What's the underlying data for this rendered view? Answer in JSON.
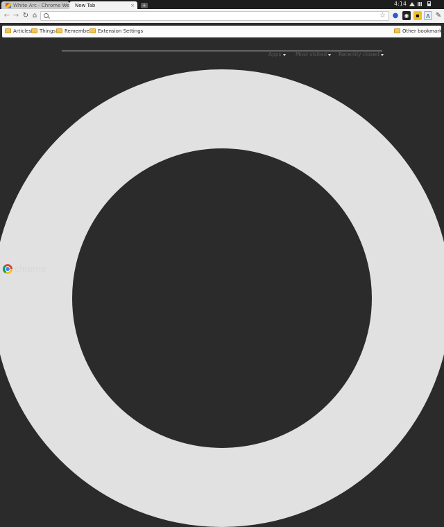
{
  "tabs": [
    {
      "title": "White Arc - Chrome We...",
      "close": "×"
    },
    {
      "title": "New Tab",
      "close": "×"
    }
  ],
  "new_tab_symbol": "+",
  "status": {
    "clock": "4:14"
  },
  "toolbar": {
    "back": "←",
    "forward": "→",
    "reload": "↻",
    "home": "⌂",
    "omnibox_value": "",
    "star": "☆",
    "mic": "🎤",
    "wrench": "🔧"
  },
  "bookmarks": {
    "items": [
      "Articles",
      "Things",
      "Remember",
      "Extension Settings"
    ],
    "other": "Other bookmarks"
  },
  "ntp": {
    "menus": [
      "Apps",
      "Most visited",
      "Recently closed"
    ]
  },
  "brand": {
    "wordmark": "chrome"
  },
  "icons": [
    "favicon-icon",
    "close-icon",
    "new-tab-icon",
    "back-icon",
    "forward-icon",
    "reload-icon",
    "home-icon",
    "search-icon",
    "star-icon",
    "mic-icon",
    "camera-extension-icon",
    "extension-icon",
    "translate-extension-icon",
    "wrench-icon",
    "folder-icon",
    "chevron-down-icon",
    "chrome-logo-icon"
  ],
  "colors": {
    "page_background": "#2b2b2b",
    "arc": "#e1e1e1",
    "tab_strip": "#1d1d1d"
  }
}
